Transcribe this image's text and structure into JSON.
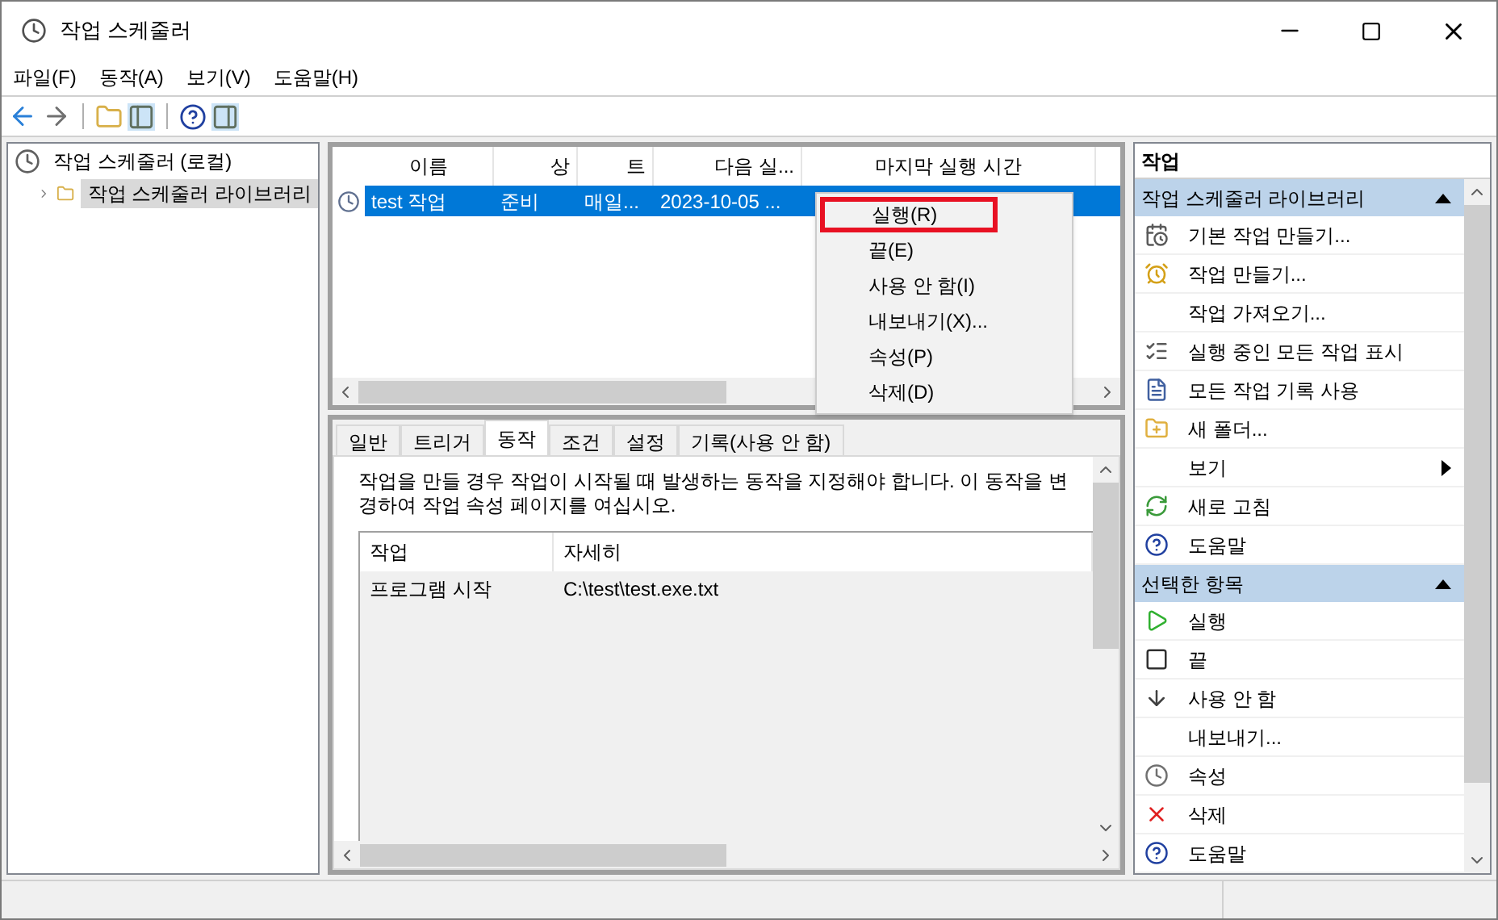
{
  "window": {
    "title": "작업 스케줄러"
  },
  "menu": [
    "파일(F)",
    "동작(A)",
    "보기(V)",
    "도움말(H)"
  ],
  "tree": [
    {
      "label": "작업 스케줄러 (로컬)",
      "selected": false,
      "children": [
        {
          "label": "작업 스케줄러 라이브러리",
          "selected": true,
          "expanded": false
        }
      ]
    }
  ],
  "task_list": {
    "columns": [
      "이름",
      "상",
      "트",
      "다음 실...",
      "마지막 실행 시간"
    ],
    "rows": [
      {
        "cells": [
          "test 작업",
          "준비",
          "매일...",
          "2023-10-05 ..."
        ],
        "selected": true
      }
    ]
  },
  "context_menu": [
    {
      "label": "실행(R)",
      "highlighted": true
    },
    {
      "label": "끝(E)",
      "highlighted": false
    },
    {
      "label": "사용 안 함(I)",
      "highlighted": false
    },
    {
      "label": "내보내기(X)...",
      "highlighted": false
    },
    {
      "label": "속성(P)",
      "highlighted": false
    },
    {
      "label": "삭제(D)",
      "highlighted": false
    }
  ],
  "tabs": [
    {
      "label": "일반",
      "selected": false
    },
    {
      "label": "트리거",
      "selected": false
    },
    {
      "label": "동작",
      "selected": true
    },
    {
      "label": "조건",
      "selected": false
    },
    {
      "label": "설정",
      "selected": false
    },
    {
      "label": "기록(사용 안 함)",
      "selected": false
    }
  ],
  "action_tab": {
    "description": "작업을 만들 경우 작업이 시작될 때 발생하는 동작을 지정해야 합니다. 이 동작을 변경하여 작업 속성 페이지를 여십시오.",
    "columns": [
      "작업",
      "자세히"
    ],
    "rows": [
      [
        "프로그램 시작",
        "C:\\test\\test.exe.txt"
      ]
    ]
  },
  "actions_pane": {
    "title": "작업",
    "sections": [
      {
        "title": "작업 스케줄러 라이브러리",
        "expanded": true,
        "items": [
          {
            "label": "기본 작업 만들기...",
            "submenu": false
          },
          {
            "label": "작업 만들기...",
            "submenu": false
          },
          {
            "label": "작업 가져오기...",
            "submenu": false
          },
          {
            "label": "실행 중인 모든 작업 표시",
            "submenu": false
          },
          {
            "label": "모든 작업 기록 사용",
            "submenu": false
          },
          {
            "label": "새 폴더...",
            "submenu": false
          },
          {
            "label": "보기",
            "submenu": true
          },
          {
            "label": "새로 고침",
            "submenu": false
          },
          {
            "label": "도움말",
            "submenu": false
          }
        ]
      },
      {
        "title": "선택한 항목",
        "expanded": true,
        "items": [
          {
            "label": "실행",
            "submenu": false
          },
          {
            "label": "끝",
            "submenu": false
          },
          {
            "label": "사용 안 함",
            "submenu": false
          },
          {
            "label": "내보내기...",
            "submenu": false
          },
          {
            "label": "속성",
            "submenu": false
          },
          {
            "label": "삭제",
            "submenu": false
          },
          {
            "label": "도움말",
            "submenu": false
          }
        ]
      }
    ]
  }
}
